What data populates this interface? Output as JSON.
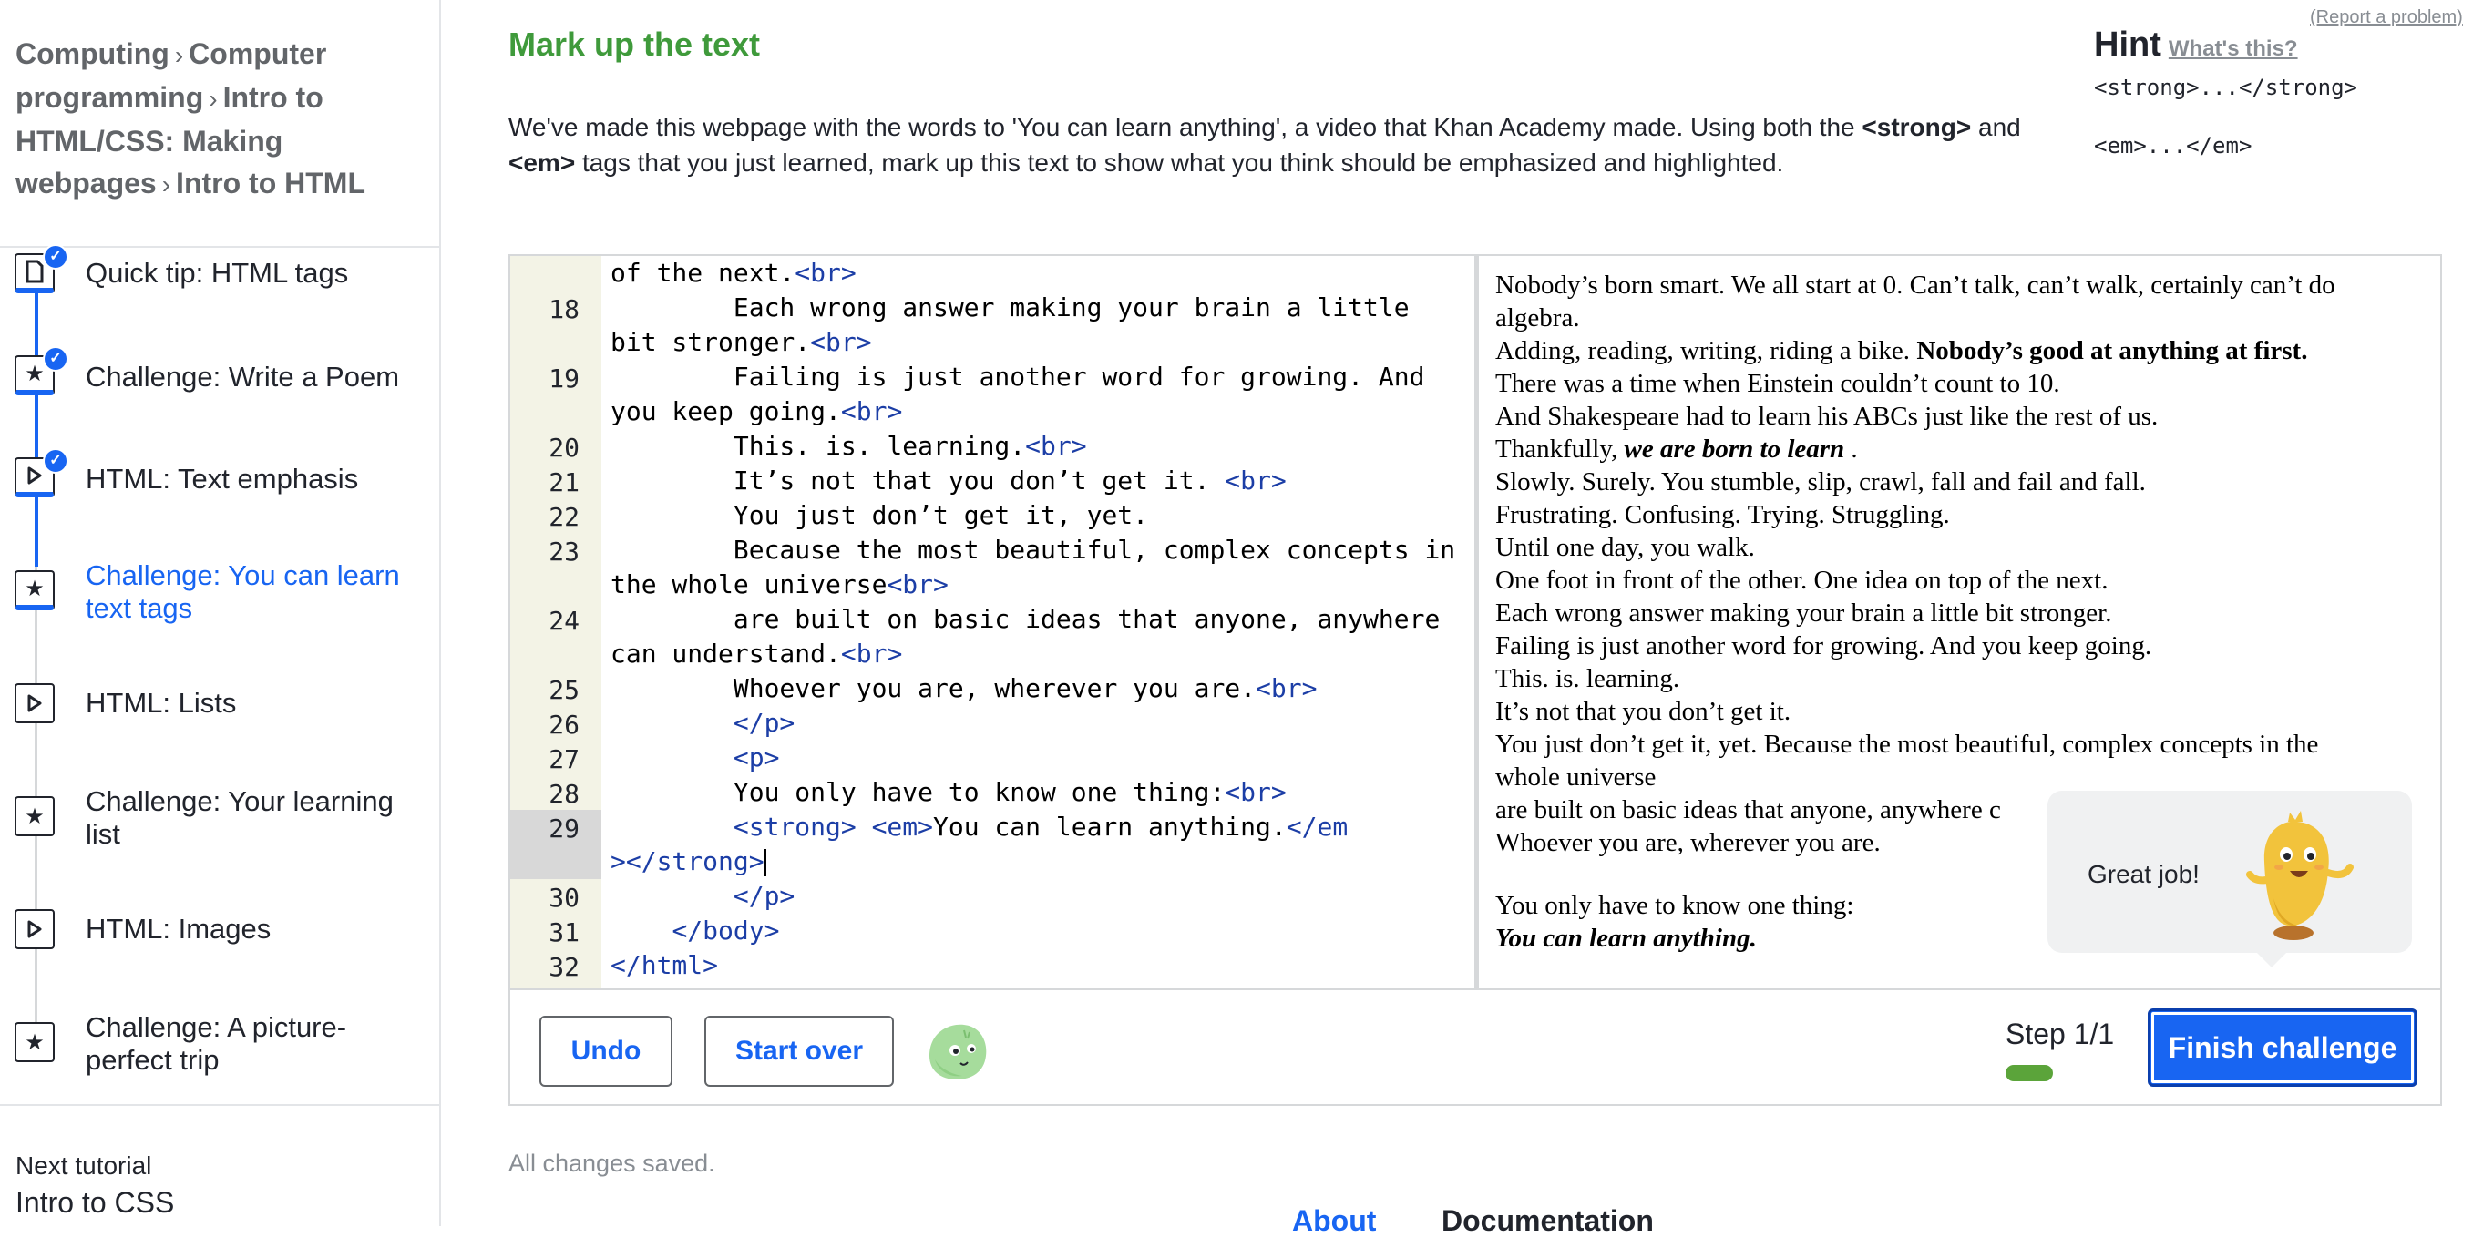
{
  "breadcrumb": {
    "items": [
      "Computing",
      "Computer programming",
      "Intro to HTML/CSS: Making webpages",
      "Intro to HTML"
    ],
    "separator": "›"
  },
  "sidebar": {
    "lessons": [
      {
        "label": "Quick tip: HTML tags",
        "icon": "article-icon",
        "completed": true
      },
      {
        "label": "Challenge: Write a Poem",
        "icon": "star-icon",
        "completed": true
      },
      {
        "label": "HTML: Text emphasis",
        "icon": "play-icon",
        "completed": true
      },
      {
        "label": "Challenge: You can learn text tags",
        "icon": "star-icon",
        "completed": false,
        "current": true
      },
      {
        "label": "HTML: Lists",
        "icon": "play-icon",
        "completed": false
      },
      {
        "label": "Challenge: Your learning list",
        "icon": "star-icon",
        "completed": false
      },
      {
        "label": "HTML: Images",
        "icon": "play-icon",
        "completed": false
      },
      {
        "label": "Challenge: A picture-perfect trip",
        "icon": "star-icon",
        "completed": false
      }
    ],
    "next_tutorial_caption": "Next tutorial",
    "next_tutorial_title": "Intro to CSS"
  },
  "challenge": {
    "title": "Mark up the text",
    "report_problem": "(Report a problem)",
    "instructions_1": "We've made this webpage with the words to 'You can learn anything', a video that Khan Academy made. Using both the ",
    "instructions_strong": "<strong>",
    "instructions_2": " and",
    "instructions_em": "<em>",
    "instructions_3": " tags that you just learned, mark up this text to show what you think should be emphasized and highlighted."
  },
  "hint": {
    "title": "Hint",
    "whats_this": "What's this?",
    "strong_code": "<strong>...</strong>",
    "em_code": "<em>...</em>"
  },
  "editor": {
    "current_line": "29",
    "rows": [
      {
        "ln": "",
        "text": "of the next.",
        "tag": "<br>"
      },
      {
        "ln": "18",
        "text": "        Each wrong answer making your brain a little",
        "tag": ""
      },
      {
        "ln": "",
        "text": "bit stronger.",
        "tag": "<br>"
      },
      {
        "ln": "19",
        "text": "        Failing is just another word for growing. And",
        "tag": ""
      },
      {
        "ln": "",
        "text": "you keep going.",
        "tag": "<br>"
      },
      {
        "ln": "20",
        "text": "        This. is. learning.",
        "tag": "<br>"
      },
      {
        "ln": "21",
        "text": "        It’s not that you don’t get it. ",
        "tag": "<br>"
      },
      {
        "ln": "22",
        "text": "        You just don’t get it, yet.",
        "tag": ""
      },
      {
        "ln": "23",
        "text": "        Because the most beautiful, complex concepts in",
        "tag": ""
      },
      {
        "ln": "",
        "text": "the whole universe",
        "tag": "<br>"
      },
      {
        "ln": "24",
        "text": "        are built on basic ideas that anyone, anywhere",
        "tag": ""
      },
      {
        "ln": "",
        "text": "can understand.",
        "tag": "<br>"
      },
      {
        "ln": "25",
        "text": "        Whoever you are, wherever you are.",
        "tag": "<br>"
      },
      {
        "ln": "26",
        "text": "        ",
        "tag": "</p>"
      },
      {
        "ln": "27",
        "text": "        ",
        "tag": "<p>"
      },
      {
        "ln": "28",
        "text": "        You only have to know one thing:",
        "tag": "<br>"
      },
      {
        "ln": "29",
        "text": "        ",
        "tag": "<strong> <em>",
        "after": "You can learn anything.",
        "tag2": "</em"
      },
      {
        "ln": "",
        "text": "",
        "tag": "></strong>",
        "caret": true
      },
      {
        "ln": "30",
        "text": "        ",
        "tag": "</p>"
      },
      {
        "ln": "31",
        "text": "    ",
        "tag": "</body>"
      },
      {
        "ln": "32",
        "text": "",
        "tag": "</html>"
      }
    ]
  },
  "output": {
    "lines": [
      {
        "text": "Nobody’s born smart. We all start at 0. Can’t talk, can’t walk, certainly can’t do"
      },
      {
        "text": "algebra."
      },
      {
        "text": "Adding, reading, writing, riding a bike. ",
        "bold": "Nobody’s good at anything at first."
      },
      {
        "text": "There was a time when Einstein couldn’t count to 10."
      },
      {
        "text": "And Shakespeare had to learn his ABCs just like the rest of us."
      },
      {
        "text": "Thankfully, ",
        "bolditalic": "we are born to learn",
        "after": " ."
      },
      {
        "text": "Slowly. Surely. You stumble, slip, crawl, fall and fail and fall."
      },
      {
        "text": "Frustrating. Confusing. Trying. Struggling."
      },
      {
        "text": "Until one day, you walk."
      },
      {
        "text": "One foot in front of the other. One idea on top of the next."
      },
      {
        "text": "Each wrong answer making your brain a little bit stronger."
      },
      {
        "text": "Failing is just another word for growing. And you keep going."
      },
      {
        "text": "This. is. learning."
      },
      {
        "text": "It’s not that you don’t get it."
      },
      {
        "text": "You just don’t get it, yet. Because the most beautiful, complex concepts in the"
      },
      {
        "text": "whole universe"
      },
      {
        "text": "are built on basic ideas that anyone, anywhere c"
      },
      {
        "text": "Whoever you are, wherever you are."
      },
      {
        "gap": true
      },
      {
        "text": "You only have to know one thing:"
      },
      {
        "bolditalic": "You can learn anything."
      }
    ]
  },
  "toolbar": {
    "undo_label": "Undo",
    "start_over_label": "Start over",
    "step_label": "Step 1/1",
    "step_progress": 1.0,
    "finish_label": "Finish challenge"
  },
  "popup": {
    "text": "Great job!"
  },
  "footer": {
    "saved_status": "All changes saved.",
    "tab_about": "About",
    "tab_documentation": "Documentation"
  },
  "colors": {
    "accent": "#1865f2",
    "title_green": "#3f9a3b",
    "progress_green": "#5ba43a",
    "tag_blue": "#1c3ea6"
  }
}
